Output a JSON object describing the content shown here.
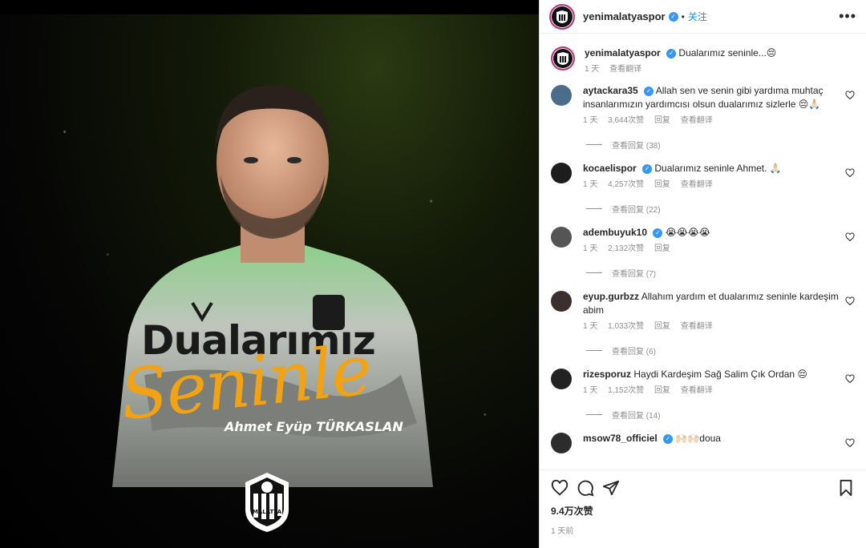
{
  "post": {
    "author": "yenimalatyaspor",
    "follow_label": "关注",
    "dot": "•",
    "more": "•••"
  },
  "media": {
    "headline": "Dualarımız",
    "script": "Seninle",
    "player_name": "Ahmet Eyüp TÜRKASLAN",
    "crest_text": "MALATYA"
  },
  "caption": {
    "user": "yenimalatyaspor",
    "text": "Dualarımız seninle...😔",
    "time": "1 天",
    "translate": "查看翻译"
  },
  "comments": [
    {
      "user": "aytackara35",
      "verified": true,
      "text": "Allah sen ve senin gibi yardıma muhtaç insanlarımızın yardımcısı olsun dualarımız sizlerle 😔🙏🏻",
      "time": "1 天",
      "likes": "3,644次赞",
      "reply": "回复",
      "translate": "查看翻译",
      "replies": "查看回复 (38)",
      "avatar_color": "#4a6d8c"
    },
    {
      "user": "kocaelispor",
      "verified": true,
      "text": "Dualarımız seninle Ahmet. 🙏🏻",
      "time": "1 天",
      "likes": "4,257次赞",
      "reply": "回复",
      "translate": "查看翻译",
      "replies": "查看回复 (22)",
      "avatar_color": "#1d1d1d"
    },
    {
      "user": "adembuyuk10",
      "verified": true,
      "text": "😭😭😭😭",
      "time": "1 天",
      "likes": "2,132次赞",
      "reply": "回复",
      "translate": "",
      "replies": "查看回复 (7)",
      "avatar_color": "#555555"
    },
    {
      "user": "eyup.gurbzz",
      "verified": false,
      "text": "Allahım yardım et dualarımız seninle kardeşim abim",
      "time": "1 天",
      "likes": "1,033次赞",
      "reply": "回复",
      "translate": "查看翻译",
      "replies": "查看回复 (6)",
      "avatar_color": "#3a2f2a"
    },
    {
      "user": "rizesporuz",
      "verified": false,
      "text": "Haydi Kardeşim Sağ Salim Çık Ordan 😔",
      "time": "1 天",
      "likes": "1,152次赞",
      "reply": "回复",
      "translate": "查看翻译",
      "replies": "查看回复 (14)",
      "avatar_color": "#222222"
    },
    {
      "user": "msow78_officiel",
      "verified": true,
      "text": "🙌🏻🙌🏻doua",
      "time": "",
      "likes": "",
      "reply": "",
      "translate": "",
      "replies": "",
      "avatar_color": "#2c2c2c"
    }
  ],
  "footer": {
    "likes": "9.4万次赞",
    "ago": "1 天前"
  },
  "colors": {
    "accent": "#0095f6",
    "verified": "#3897f0",
    "script_gold": "#f1a215"
  }
}
